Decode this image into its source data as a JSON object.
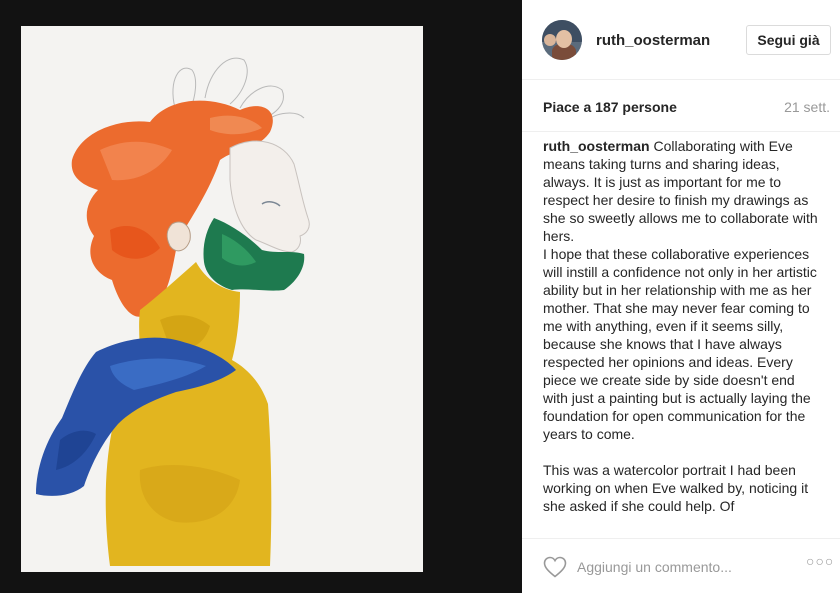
{
  "post": {
    "username": "ruth_oosterman",
    "follow_label": "Segui già",
    "likes_text": "Piace a 187 persone",
    "time_text": "21 sett.",
    "caption_author": "ruth_oosterman",
    "caption_text": "Collaborating with Eve means taking turns and sharing ideas, always. It is just as important for me to respect her desire to finish my drawings as she so sweetly allows me to collaborate with hers.\nI hope that these collaborative experiences will instill a confidence not only in her artistic ability but in her relationship with me as her mother. That she may never fear coming to me with anything, even if it seems silly, because she knows that I have always respected her opinions and ideas. Every piece we create side by side doesn't end with just a painting but is actually laying the foundation for open communication for the years to come.\n\nThis was a watercolor portrait I had been working on when Eve walked by, noticing it she asked if she could help. Of",
    "comment_placeholder": "Aggiungi un commento...",
    "more_label": "○○○"
  },
  "icons": {
    "heart": "heart-outline-icon",
    "more": "more-options-icon",
    "avatar": "profile-avatar"
  },
  "colors": {
    "text": "#262626",
    "muted": "#999999",
    "border": "#efefef",
    "photo_bg": "#121212",
    "paper": "#f4f3f1"
  }
}
